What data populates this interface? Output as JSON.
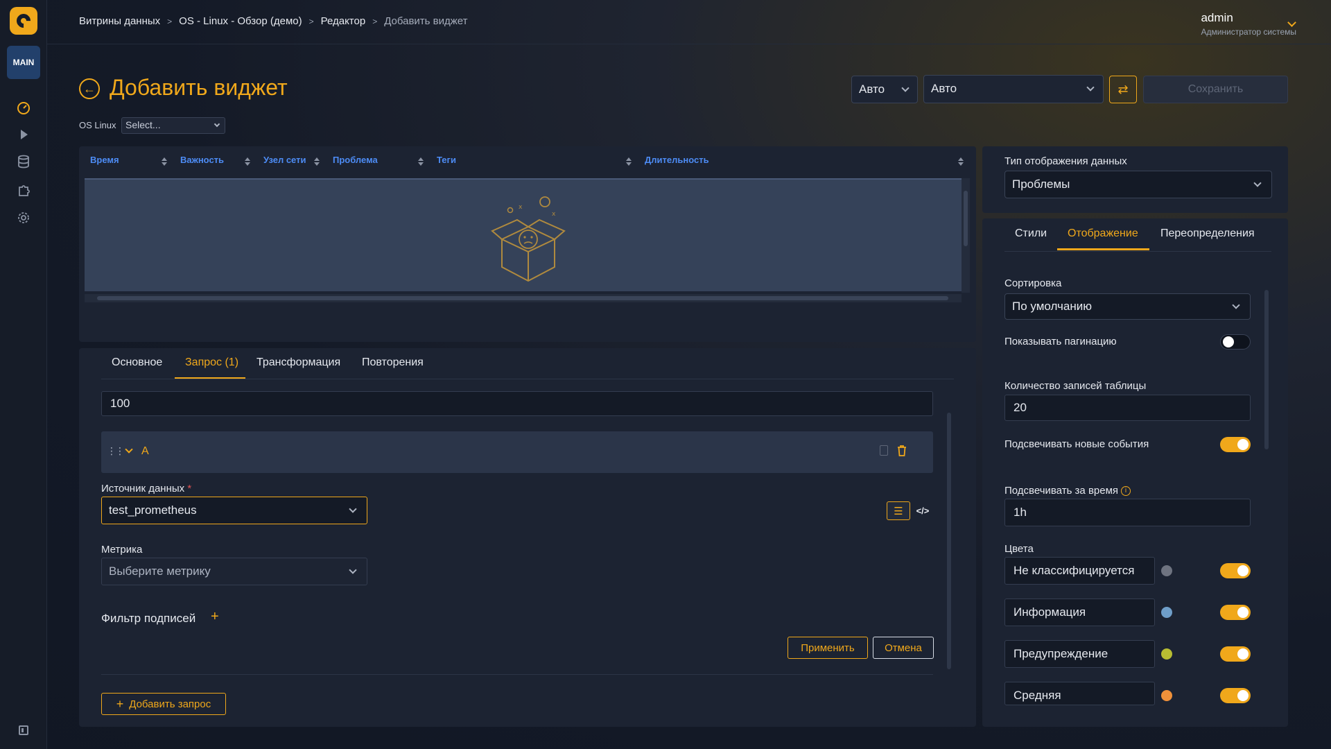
{
  "sidebar": {
    "badge": "MAIN",
    "icons": [
      "dashboard-icon",
      "play-icon",
      "database-icon",
      "puzzle-icon",
      "gear-icon"
    ]
  },
  "breadcrumbs": [
    "Витрины данных",
    "OS - Linux - Обзор (демо)",
    "Редактор",
    "Добавить виджет"
  ],
  "user": {
    "name": "admin",
    "role": "Администратор системы"
  },
  "header": {
    "title": "Добавить виджет",
    "variable_label": "OS Linux",
    "variable_value": "Select...",
    "interval_value": "Авто",
    "timerange_value": "Авто",
    "save_label": "Сохранить"
  },
  "table": {
    "columns": [
      "Время",
      "Важность",
      "Узел сети",
      "Проблема",
      "Теги",
      "Длительность"
    ]
  },
  "editor": {
    "tabs": [
      "Основное",
      "Запрос (1)",
      "Трансформация",
      "Повторения"
    ],
    "active_tab": "Запрос (1)",
    "limit_value": "100",
    "query_name": "A",
    "datasource_label": "Источник данных",
    "datasource_required": "*",
    "datasource_value": "test_prometheus",
    "metric_label": "Метрика",
    "metric_placeholder": "Выберите метрику",
    "label_filter": "Фильтр подписей",
    "label_filter_add": "+",
    "apply_label": "Применить",
    "cancel_label": "Отмена",
    "add_query_label": "Добавить запрос",
    "add_query_icon": "+"
  },
  "right": {
    "display_type_label": "Тип отображения данных",
    "display_type_value": "Проблемы",
    "tabs": [
      "Стили",
      "Отображение",
      "Переопределения"
    ],
    "active_tab": "Отображение",
    "sort_label": "Сортировка",
    "sort_value": "По умолчанию",
    "pagination_label": "Показывать пагинацию",
    "pagination_on": false,
    "rows_label": "Количество записей таблицы",
    "rows_value": "20",
    "highlight_label": "Подсвечивать новые события",
    "highlight_on": true,
    "highlight_time_label": "Подсвечивать за время",
    "highlight_time_value": "1h",
    "colors_label": "Цвета",
    "colors": [
      {
        "name": "Не классифицируется",
        "color": "#6e7380",
        "on": true
      },
      {
        "name": "Информация",
        "color": "#6f9ec9",
        "on": true
      },
      {
        "name": "Предупреждение",
        "color": "#b7bd32",
        "on": true
      },
      {
        "name": "Средняя",
        "color": "#f0913a",
        "on": true
      }
    ]
  },
  "colors": {
    "accent": "#f0a81b",
    "link": "#4d8cf5",
    "panel": "#1c2332"
  }
}
